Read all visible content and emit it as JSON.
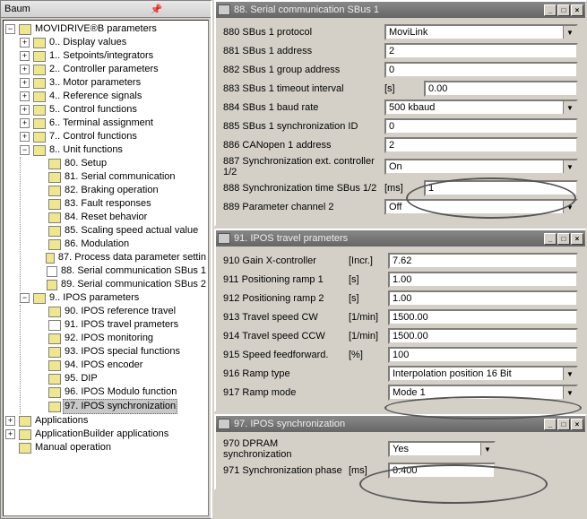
{
  "left": {
    "title": "Baum",
    "root": "MOVIDRIVE®B parameters",
    "top_closed": [
      "0.. Display values",
      "1.. Setpoints/integrators",
      "2.. Controller parameters",
      "3.. Motor parameters",
      "4.. Reference signals",
      "5.. Control functions",
      "6.. Terminal assignment",
      "7.. Control functions"
    ],
    "unit_label": "8.. Unit functions",
    "unit_children": [
      "80. Setup",
      "81. Serial communication",
      "82. Braking operation",
      "83. Fault responses",
      "84. Reset behavior",
      "85. Scaling speed actual value",
      "86. Modulation",
      "87. Process data parameter settin",
      "88. Serial communication SBus 1",
      "89. Serial communication SBus 2"
    ],
    "ipos_label": "9.. IPOS parameters",
    "ipos_children": [
      "90. IPOS reference travel",
      "91. IPOS travel prameters",
      "92. IPOS monitoring",
      "93. IPOS special functions",
      "94. IPOS encoder",
      "95. DIP",
      "96. IPOS Modulo function",
      "97. IPOS synchronization"
    ],
    "bottom": [
      "Applications",
      "ApplicationBuilder applications",
      "Manual operation"
    ]
  },
  "win88": {
    "title": "88. Serial communication SBus 1",
    "r880": {
      "l": "880 SBus 1 protocol",
      "v": "MoviLink",
      "t": "sel"
    },
    "r881": {
      "l": "881 SBus 1 address",
      "v": "2",
      "t": "in"
    },
    "r882": {
      "l": "882 SBus 1 group address",
      "v": "0",
      "t": "in"
    },
    "r883": {
      "l": "883 SBus 1 timeout interval",
      "u": "[s]",
      "v": "0.00",
      "t": "in"
    },
    "r884": {
      "l": "884 SBus 1 baud rate",
      "v": "500 kbaud",
      "t": "sel"
    },
    "r885": {
      "l": "885 SBus 1 synchronization ID",
      "v": "0",
      "t": "in"
    },
    "r886": {
      "l": "886 CANopen 1 address",
      "v": "2",
      "t": "in"
    },
    "r887": {
      "l": "887 Synchronization ext. controller 1/2",
      "v": "On",
      "t": "sel"
    },
    "r888": {
      "l": "888 Synchronization time SBus 1/2",
      "u": "[ms]",
      "v": "1",
      "t": "in"
    },
    "r889": {
      "l": "889 Parameter channel 2",
      "v": "Off",
      "t": "sel"
    }
  },
  "win91": {
    "title": "91. IPOS travel prameters",
    "r910": {
      "l": "910 Gain X-controller",
      "u": "[Incr.]",
      "v": "7.62"
    },
    "r911": {
      "l": "911 Positioning ramp 1",
      "u": "[s]",
      "v": "1.00"
    },
    "r912": {
      "l": "912 Positioning ramp 2",
      "u": "[s]",
      "v": "1.00"
    },
    "r913": {
      "l": "913 Travel speed CW",
      "u": "[1/min]",
      "v": "1500.00"
    },
    "r914": {
      "l": "914 Travel speed CCW",
      "u": "[1/min]",
      "v": "1500.00"
    },
    "r915": {
      "l": "915 Speed feedforward.",
      "u": "[%]",
      "v": "100"
    },
    "r916": {
      "l": "916 Ramp type",
      "v": "Interpolation position 16 Bit",
      "t": "sel"
    },
    "r917": {
      "l": "917 Ramp mode",
      "v": "Mode 1",
      "t": "sel"
    }
  },
  "win97": {
    "title": "97. IPOS synchronization",
    "r970": {
      "l": "970 DPRAM synchronization",
      "v": "Yes",
      "t": "sel"
    },
    "r971": {
      "l": "971 Synchronization phase",
      "u": "[ms]",
      "v": "0.400"
    }
  }
}
